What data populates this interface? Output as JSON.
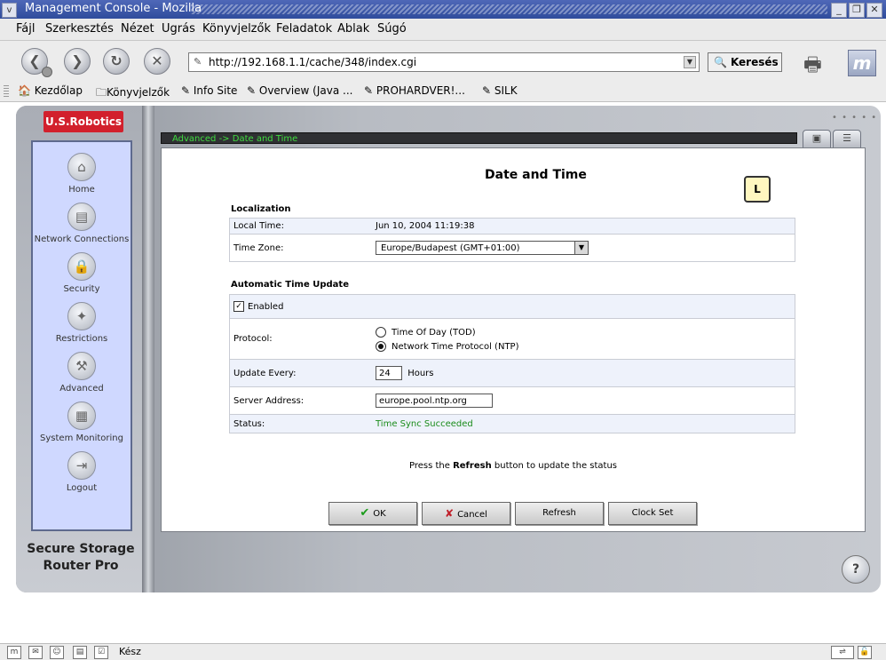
{
  "window": {
    "title": "Management Console - Mozilla",
    "menu_glyph": "v",
    "minimize_glyph": "_",
    "maximize_glyph": "❐",
    "close_glyph": "✕"
  },
  "menubar": {
    "items": [
      "Fájl",
      "Szerkesztés",
      "Nézet",
      "Ugrás",
      "Könyvjelzők",
      "Feladatok",
      "Ablak",
      "Súgó"
    ]
  },
  "navbar": {
    "back_glyph": "❮",
    "forward_glyph": "❯",
    "reload_glyph": "↻",
    "stop_glyph": "✕",
    "url": "http://192.168.1.1/cache/348/index.cgi",
    "search_label": "Keresés"
  },
  "bookmarks": {
    "home": "Kezdőlap",
    "folder": "Könyvjelzők",
    "items": [
      "Info Site",
      "Overview (Java ...",
      "PROHARDVER!...",
      "SILK"
    ]
  },
  "app": {
    "brand": "U.S.Robotics",
    "product_line1": "Secure Storage",
    "product_line2": "Router Pro",
    "dots": "• • • • •",
    "tab1_glyph": "▣",
    "tab2_glyph": "☰",
    "help_glyph": "?",
    "breadcrumb": "Advanced -> Date and Time",
    "nav": [
      {
        "label": "Home",
        "glyph": "⌂"
      },
      {
        "label": "Network Connections",
        "glyph": "▤"
      },
      {
        "label": "Security",
        "glyph": "🔒"
      },
      {
        "label": "Restrictions",
        "glyph": "✦"
      },
      {
        "label": "Advanced",
        "glyph": "⚒"
      },
      {
        "label": "System Monitoring",
        "glyph": "▦"
      },
      {
        "label": "Logout",
        "glyph": "⇥"
      }
    ]
  },
  "page": {
    "heading": "Date and Time",
    "clock_glyph": "L",
    "localization": {
      "title": "Localization",
      "local_time_label": "Local Time:",
      "local_time_value": "Jun 10, 2004 11:19:38",
      "timezone_label": "Time Zone:",
      "timezone_value": "Europe/Budapest (GMT+01:00)"
    },
    "auto_update": {
      "title": "Automatic Time Update",
      "enabled_label": "Enabled",
      "check_glyph": "✓",
      "protocol_label": "Protocol:",
      "protocol_options": [
        "Time Of Day (TOD)",
        "Network Time Protocol (NTP)"
      ],
      "protocol_selected": "Network Time Protocol (NTP)",
      "update_every_label": "Update Every:",
      "update_every_value": "24",
      "update_every_unit": "Hours",
      "server_label": "Server Address:",
      "server_value": "europe.pool.ntp.org",
      "status_label": "Status:",
      "status_value": "Time Sync Succeeded"
    },
    "note_prefix": "Press the",
    "note_bold": "Refresh",
    "note_suffix": "button to update the status",
    "buttons": {
      "ok": "OK",
      "cancel": "Cancel",
      "refresh": "Refresh",
      "clock_set": "Clock Set"
    }
  },
  "statusbar": {
    "text": "Kész"
  }
}
